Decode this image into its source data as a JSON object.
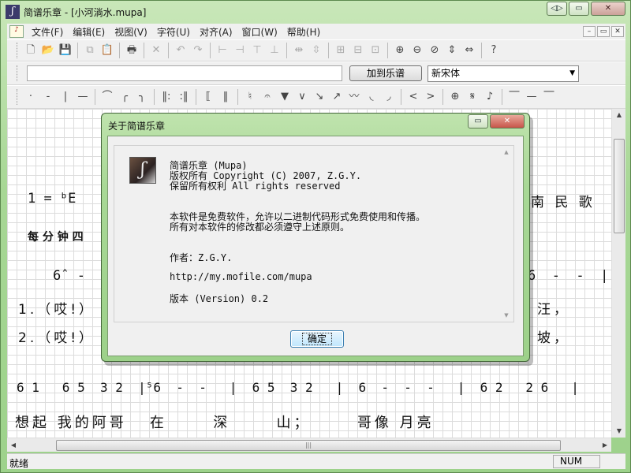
{
  "window": {
    "title": "简谱乐章 - [小河淌水.mupa]",
    "app_icon_glyph": "ʃ",
    "controls": {
      "minimize": "◁▷",
      "restore": "▭",
      "close": "✕"
    }
  },
  "menubar": {
    "items": [
      "文件(F)",
      "编辑(E)",
      "视图(V)",
      "字符(U)",
      "对齐(A)",
      "窗口(W)",
      "帮助(H)"
    ],
    "mdi_controls": {
      "minimize": "–",
      "restore": "▭",
      "close": "✕"
    }
  },
  "toolbar1": {
    "buttons": [
      {
        "name": "new-icon",
        "glyph": "🗋",
        "dim": false
      },
      {
        "name": "open-icon",
        "glyph": "📂",
        "dim": false
      },
      {
        "name": "save-icon",
        "glyph": "💾",
        "dim": false
      },
      {
        "sep": true
      },
      {
        "name": "copy-icon",
        "glyph": "⧉",
        "dim": true
      },
      {
        "name": "paste-icon",
        "glyph": "📋",
        "dim": true
      },
      {
        "sep": true
      },
      {
        "name": "print-icon",
        "glyph": "🖶",
        "dim": false
      },
      {
        "sep": true
      },
      {
        "name": "delete-icon",
        "glyph": "✕",
        "dim": true
      },
      {
        "sep": true
      },
      {
        "name": "undo-icon",
        "glyph": "↶",
        "dim": true
      },
      {
        "name": "redo-icon",
        "glyph": "↷",
        "dim": true
      },
      {
        "sep": true
      },
      {
        "name": "align-left-icon",
        "glyph": "⊢",
        "dim": true
      },
      {
        "name": "align-right-icon",
        "glyph": "⊣",
        "dim": true
      },
      {
        "name": "align-top-icon",
        "glyph": "⊤",
        "dim": true
      },
      {
        "name": "align-bottom-icon",
        "glyph": "⊥",
        "dim": true
      },
      {
        "sep": true
      },
      {
        "name": "space-horizontal-icon",
        "glyph": "⇹",
        "dim": true
      },
      {
        "name": "space-vertical-icon",
        "glyph": "⇳",
        "dim": true
      },
      {
        "sep": true
      },
      {
        "name": "group-icon",
        "glyph": "⊞",
        "dim": true
      },
      {
        "name": "ungroup-icon",
        "glyph": "⊟",
        "dim": true
      },
      {
        "name": "grid-icon",
        "glyph": "⊡",
        "dim": true
      },
      {
        "sep": true
      },
      {
        "name": "zoom-in-icon",
        "glyph": "⊕",
        "dim": false
      },
      {
        "name": "zoom-out-icon",
        "glyph": "⊖",
        "dim": false
      },
      {
        "name": "zoom-reset-icon",
        "glyph": "⊘",
        "dim": false
      },
      {
        "name": "fit-height-icon",
        "glyph": "⇕",
        "dim": false
      },
      {
        "name": "fit-width-icon",
        "glyph": "⇔",
        "dim": false
      },
      {
        "sep": true
      },
      {
        "name": "help-icon",
        "glyph": "?",
        "dim": false
      }
    ]
  },
  "toolbar2": {
    "input_value": "",
    "add_button": "加到乐谱",
    "font_select": "新宋体",
    "font_arrow": "▼"
  },
  "toolbar3": {
    "buttons": [
      {
        "name": "dot-icon",
        "glyph": "·"
      },
      {
        "name": "dash-icon",
        "glyph": "-"
      },
      {
        "name": "barline-icon",
        "glyph": "|"
      },
      {
        "name": "long-dash-icon",
        "glyph": "—"
      },
      {
        "sep": true
      },
      {
        "name": "slur-icon",
        "glyph": "⌒"
      },
      {
        "name": "slur-left-icon",
        "glyph": "╭"
      },
      {
        "name": "slur-right-icon",
        "glyph": "╮"
      },
      {
        "sep": true
      },
      {
        "name": "repeat-start-icon",
        "glyph": "‖:"
      },
      {
        "name": "repeat-end-icon",
        "glyph": ":‖"
      },
      {
        "sep": true
      },
      {
        "name": "bracket-icon",
        "glyph": "⟦"
      },
      {
        "name": "double-bar-icon",
        "glyph": "‖"
      },
      {
        "sep": true
      },
      {
        "name": "natural-icon",
        "glyph": "♮"
      },
      {
        "name": "fermata-icon",
        "glyph": "𝄐"
      },
      {
        "name": "triangle-down-icon",
        "glyph": "▼"
      },
      {
        "name": "v-accent-icon",
        "glyph": "∨"
      },
      {
        "name": "arrow-down-right-icon",
        "glyph": "↘"
      },
      {
        "name": "arrow-up-right-icon",
        "glyph": "↗"
      },
      {
        "name": "trill-icon",
        "glyph": "〰"
      },
      {
        "name": "curve-left-icon",
        "glyph": "◟"
      },
      {
        "name": "curve-right-icon",
        "glyph": "◞"
      },
      {
        "sep": true
      },
      {
        "name": "crescendo-icon",
        "glyph": "<"
      },
      {
        "name": "decrescendo-icon",
        "glyph": ">"
      },
      {
        "sep": true
      },
      {
        "name": "coda-icon",
        "glyph": "⊕"
      },
      {
        "name": "segno-icon",
        "glyph": "𝄋"
      },
      {
        "name": "note-icon",
        "glyph": "♪"
      },
      {
        "sep": true
      },
      {
        "name": "line-1-icon",
        "glyph": "⎺"
      },
      {
        "name": "line-2-icon",
        "glyph": "—"
      },
      {
        "name": "line-3-icon",
        "glyph": "⎺"
      }
    ]
  },
  "score": {
    "key": "1 = ᵇE",
    "tempo": "每 分 钟 四",
    "genre": "南 民 歌",
    "row1_left": "6̂  -  -",
    "row1_right": "6  -  -  |",
    "lyric1_left": "1.（哎!）",
    "lyric1_right": "汪，",
    "lyric2_left": "2.（哎!）",
    "lyric2_right": "坡，",
    "melody": "6 1   6 5  3 2  |⁵6  -  -   |  6 5  3 2   |  6  -  -  -   |  6 2   2 6   |",
    "lyrics": "想起 我的阿哥   在      深      山；      哥像 月亮"
  },
  "status": {
    "left": "就绪",
    "num": "NUM"
  },
  "dialog": {
    "title": "关于简谱乐章",
    "logo_glyph": "ʃ",
    "lines": [
      "简谱乐章 (Mupa)",
      "版权所有 Copyright (C) 2007, Z.G.Y.",
      "保留所有权利 All rights reserved",
      "本软件是免费软件，允许以二进制代码形式免费使用和传播。",
      "所有对本软件的修改都必须遵守上述原则。",
      "作者：Z.G.Y.",
      "http://my.mofile.com/mupa",
      "版本 (Version) 0.2"
    ],
    "ok": "确定",
    "controls": {
      "restore": "▭",
      "close": "✕"
    }
  }
}
